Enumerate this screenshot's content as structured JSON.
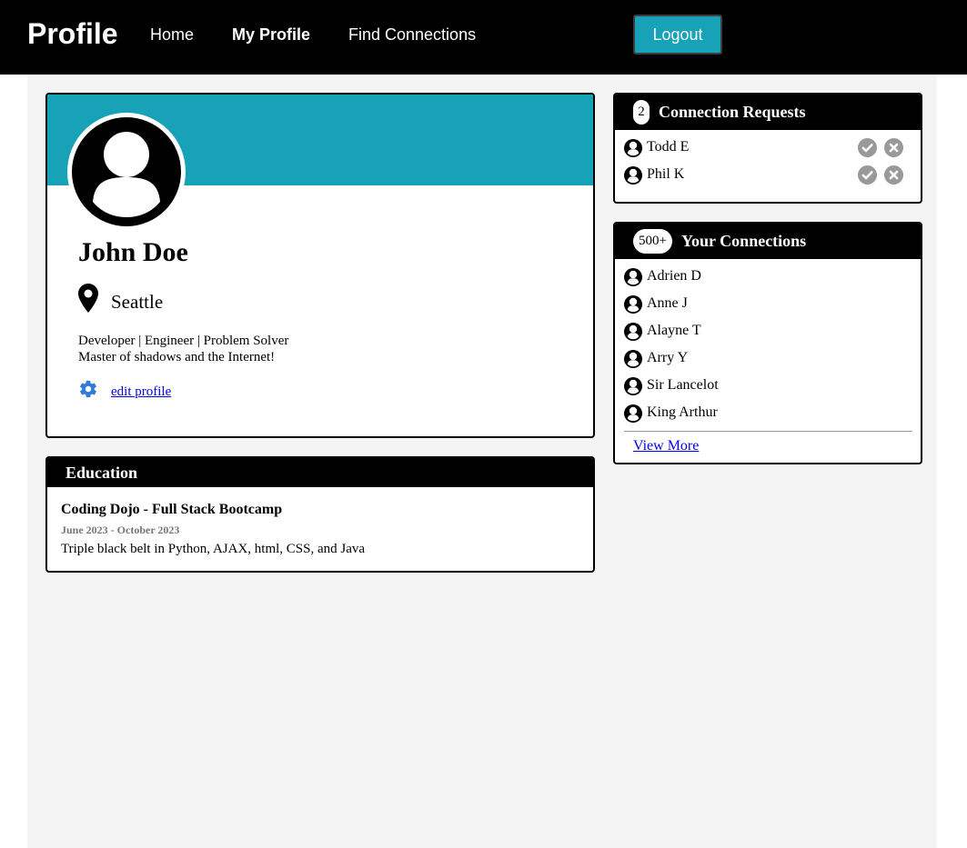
{
  "nav": {
    "brand": "Profile",
    "links": [
      "Home",
      "My Profile",
      "Find Connections"
    ],
    "logout": "Logout"
  },
  "profile": {
    "name": "John Doe",
    "location": "Seattle",
    "bio_line1": "Developer | Engineer | Problem Solver",
    "bio_line2": "Master of shadows and the Internet!",
    "edit_label": "edit profile",
    "avatar_icon": "user-circle-icon",
    "location_icon": "map-pin-icon",
    "edit_icon": "gear-icon"
  },
  "education": {
    "title": "Education",
    "school": "Coding Dojo - Full Stack Bootcamp",
    "dates": "June 2023 - October 2023",
    "description": "Triple black belt in Python, AJAX, html, CSS, and Java"
  },
  "requests": {
    "count": "2",
    "title": "Connection Requests",
    "items": [
      "Todd E",
      "Phil K"
    ],
    "accept_icon": "check-circle-icon",
    "reject_icon": "x-circle-icon"
  },
  "connections": {
    "count": "500+",
    "title": "Your Connections",
    "items": [
      "Adrien D",
      "Anne J",
      "Alayne T",
      "Arry Y",
      "Sir Lancelot",
      "King Arthur"
    ],
    "view_more": "View More"
  },
  "colors": {
    "accent": "#17a2b8",
    "navbar": "#000000",
    "page_bg": "#f4f4f4",
    "gear_blue": "#2e7bdc",
    "action_gray": "#999999"
  }
}
